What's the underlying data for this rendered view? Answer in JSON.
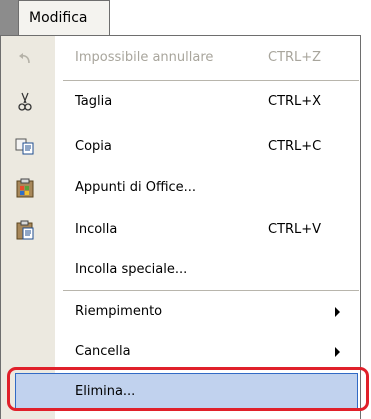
{
  "menu": {
    "title": "Modifica",
    "items": [
      {
        "label": "Impossibile annullare",
        "shortcut": "CTRL+Z",
        "icon": "undo-icon",
        "disabled": true
      },
      {
        "label": "Taglia",
        "shortcut": "CTRL+X",
        "icon": "scissors-icon"
      },
      {
        "label": "Copia",
        "shortcut": "CTRL+C",
        "icon": "copy-icon"
      },
      {
        "label": "Appunti di Office...",
        "shortcut": "",
        "icon": "office-clipboard-icon"
      },
      {
        "label": "Incolla",
        "shortcut": "CTRL+V",
        "icon": "paste-icon"
      },
      {
        "label": "Incolla speciale...",
        "shortcut": ""
      },
      {
        "label": "Riempimento",
        "shortcut": "",
        "submenu": true
      },
      {
        "label": "Cancella",
        "shortcut": "",
        "submenu": true
      },
      {
        "label": "Elimina...",
        "shortcut": "",
        "highlighted": true
      }
    ]
  },
  "colors": {
    "highlight_fill": "#c1d2ee",
    "highlight_border": "#316ac5",
    "annotation": "#e0202a",
    "gutter": "#ece9e0"
  }
}
